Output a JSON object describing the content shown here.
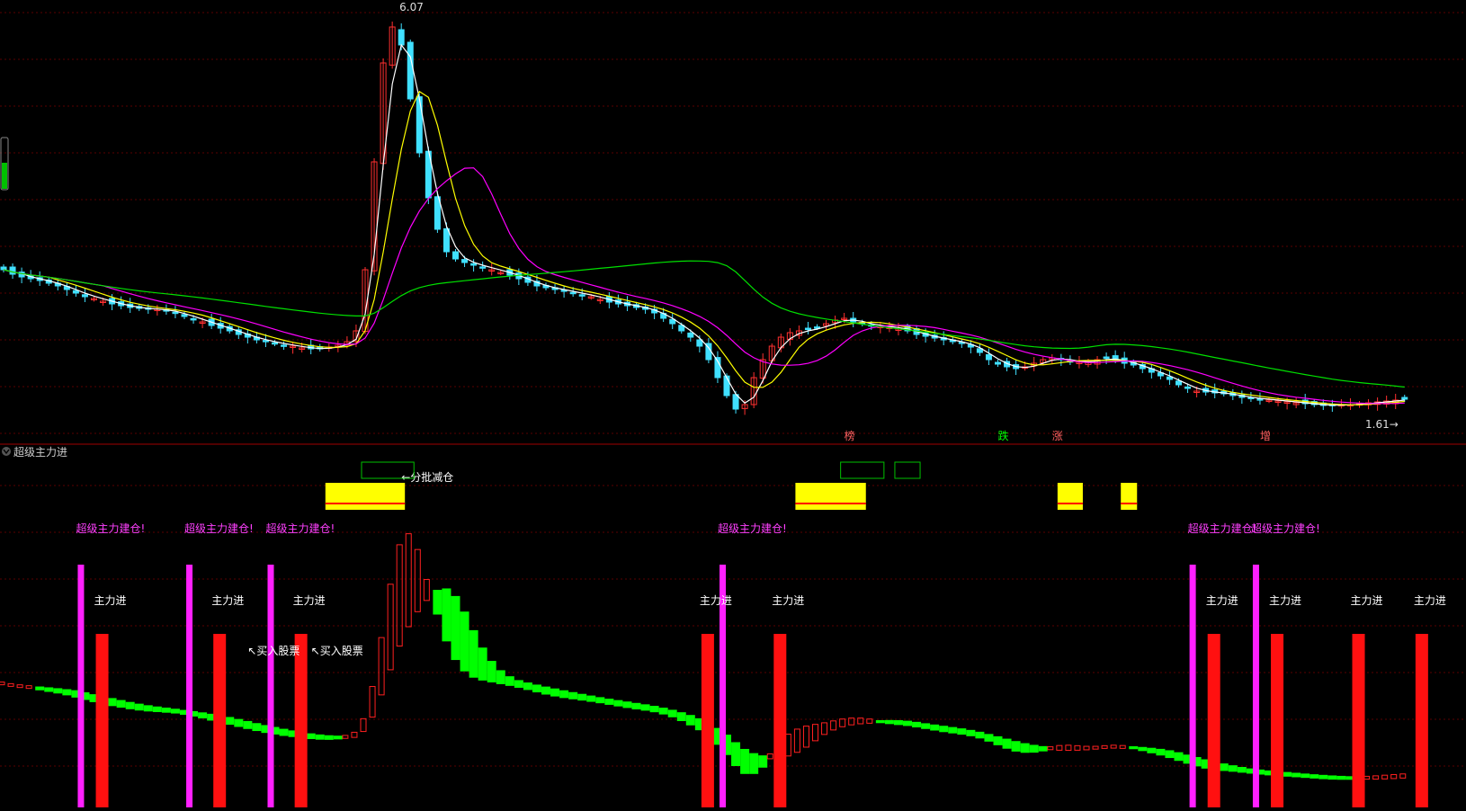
{
  "indicator": {
    "name": "超级主力进"
  },
  "chart_data": [
    {
      "type": "candlestick",
      "price_high_label": "6.07",
      "price_low_label": "1.61",
      "ylim": [
        1.5,
        6.2
      ],
      "n": 156,
      "grid": true,
      "close": [
        3.3,
        3.25,
        3.22,
        3.2,
        3.18,
        3.15,
        3.12,
        3.08,
        3.04,
        3.0,
        2.98,
        2.95,
        2.92,
        2.9,
        2.88,
        2.87,
        2.86,
        2.86,
        2.84,
        2.82,
        2.78,
        2.75,
        2.72,
        2.68,
        2.65,
        2.62,
        2.58,
        2.55,
        2.52,
        2.5,
        2.48,
        2.46,
        2.45,
        2.43,
        2.42,
        2.42,
        2.44,
        2.46,
        2.5,
        2.62,
        3.3,
        4.5,
        5.6,
        6.0,
        5.8,
        5.2,
        4.6,
        4.1,
        3.75,
        3.5,
        3.42,
        3.38,
        3.35,
        3.32,
        3.3,
        3.27,
        3.24,
        3.2,
        3.16,
        3.12,
        3.1,
        3.08,
        3.06,
        3.04,
        3.02,
        3.0,
        2.97,
        2.94,
        2.92,
        2.9,
        2.88,
        2.86,
        2.82,
        2.76,
        2.7,
        2.62,
        2.55,
        2.45,
        2.3,
        2.1,
        1.9,
        1.75,
        1.8,
        2.1,
        2.3,
        2.45,
        2.55,
        2.6,
        2.62,
        2.64,
        2.66,
        2.7,
        2.74,
        2.76,
        2.72,
        2.7,
        2.68,
        2.67,
        2.66,
        2.64,
        2.62,
        2.58,
        2.56,
        2.54,
        2.52,
        2.5,
        2.48,
        2.44,
        2.38,
        2.3,
        2.25,
        2.22,
        2.2,
        2.22,
        2.26,
        2.3,
        2.32,
        2.3,
        2.28,
        2.27,
        2.28,
        2.3,
        2.32,
        2.3,
        2.26,
        2.24,
        2.2,
        2.16,
        2.12,
        2.08,
        2.02,
        1.98,
        1.95,
        1.94,
        1.93,
        1.92,
        1.9,
        1.88,
        1.87,
        1.86,
        1.85,
        1.84,
        1.83,
        1.82,
        1.81,
        1.8,
        1.79,
        1.79,
        1.8,
        1.8,
        1.81,
        1.82,
        1.83,
        1.84,
        1.85,
        1.86
      ]
    },
    {
      "type": "indicator",
      "signals": {
        "build": "超级主力建仓!",
        "enter": "主力进",
        "buy": "↖买入股票",
        "reduce": "←分批减仓"
      },
      "build_labels": [
        {
          "i": 9
        },
        {
          "i": 21
        },
        {
          "i": 30
        },
        {
          "i": 80
        },
        {
          "i": 132
        },
        {
          "i": 139
        }
      ],
      "enter_labels": [
        {
          "i": 11
        },
        {
          "i": 24
        },
        {
          "i": 33
        },
        {
          "i": 78
        },
        {
          "i": 86
        },
        {
          "i": 134
        },
        {
          "i": 141
        },
        {
          "i": 150
        },
        {
          "i": 157
        }
      ],
      "buy_labels": [
        {
          "i": 27
        },
        {
          "i": 34
        }
      ],
      "reduce_label": {
        "i": 44
      },
      "marks_above": [
        {
          "i": 93,
          "text": "榜",
          "color": "#ff6060"
        },
        {
          "i": 110,
          "text": "跌",
          "color": "#00ff00"
        },
        {
          "i": 116,
          "text": "涨",
          "color": "#ff6060"
        },
        {
          "i": 139,
          "text": "增",
          "color": "#ff6060"
        }
      ]
    }
  ]
}
